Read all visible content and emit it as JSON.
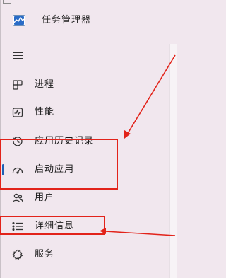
{
  "window": {
    "title": "任务管理器"
  },
  "navigation": {
    "menu_icon": "hamburger-menu-icon",
    "items": [
      {
        "label": "进程",
        "icon": "processes-icon",
        "active": false
      },
      {
        "label": "性能",
        "icon": "performance-icon",
        "active": false
      },
      {
        "label": "应用历史记录",
        "icon": "app-history-icon",
        "active": false
      },
      {
        "label": "启动应用",
        "icon": "startup-apps-icon",
        "active": true
      },
      {
        "label": "用户",
        "icon": "users-icon",
        "active": false
      },
      {
        "label": "详细信息",
        "icon": "details-icon",
        "active": false
      },
      {
        "label": "服务",
        "icon": "services-icon",
        "active": false
      }
    ]
  },
  "colors": {
    "background": "#f1e7ee",
    "active_indicator": "#1f5fb4",
    "annotation": "#e2231a",
    "text": "#1b1b1b"
  }
}
